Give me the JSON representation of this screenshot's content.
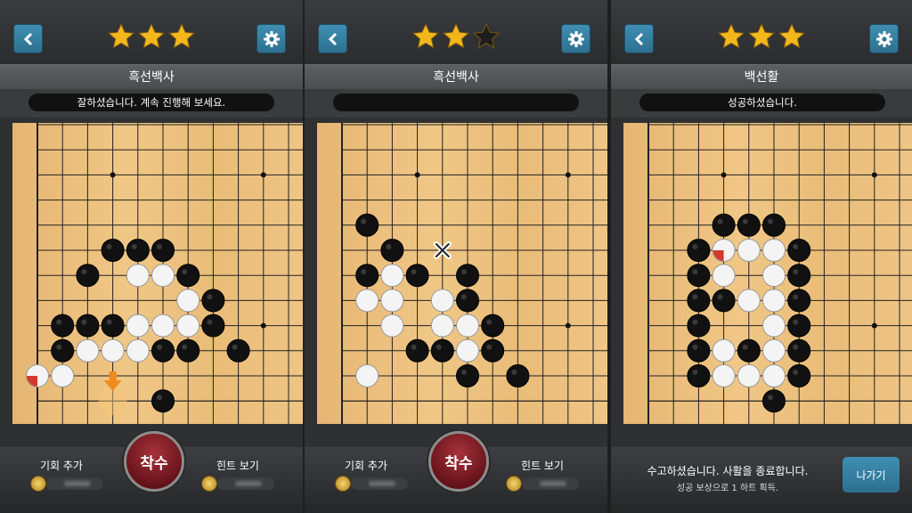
{
  "colors": {
    "accent": "#3f8fb2",
    "board": "#efc585",
    "play_button": "#8b1f28",
    "star_gold": "#f3b71c"
  },
  "icons": {
    "back": "chevron-left-icon",
    "settings": "gear-icon",
    "star": "star-icon",
    "coin": "coin-icon",
    "hint_arrow": "arrow-down-icon",
    "wrong_mark": "x-mark-icon"
  },
  "panels": [
    {
      "stars": 3,
      "stars_total": 3,
      "title": "흑선백사",
      "message": "잘하셨습니다. 계속 진행해 보세요.",
      "buttons": {
        "add_chance": "기회 추가",
        "play": "착수",
        "hint": "힌트 보기"
      }
    },
    {
      "stars": 2,
      "stars_total": 3,
      "title": "흑선백사",
      "message": "",
      "buttons": {
        "add_chance": "기회 추가",
        "play": "착수",
        "hint": "힌트 보기"
      }
    },
    {
      "stars": 3,
      "stars_total": 3,
      "title": "백선활",
      "message": "성공하셨습니다.",
      "result": {
        "line1": "수고하셨습니다. 사활을 종료합니다.",
        "line2": "성공 보상으로 1 하트 획득.",
        "exit": "나가기"
      }
    }
  ]
}
